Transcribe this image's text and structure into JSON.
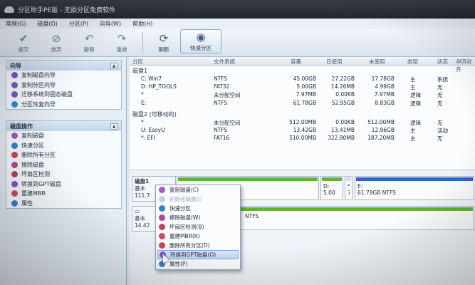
{
  "window": {
    "title": "分区助手PE版 - 无损分区免费软件"
  },
  "menu": [
    "常规(G)",
    "磁盘(D)",
    "分区(P)",
    "向导(W)",
    "帮助(H)"
  ],
  "toolbar": {
    "submit": "提交",
    "discard": "放弃",
    "undo": "撤销",
    "redo": "重做",
    "refresh": "刷新",
    "quick_partition": "快速分区"
  },
  "wizard_panel": {
    "title": "向导",
    "items": [
      "复制磁盘向导",
      "复制分区向导",
      "迁移系统到固态磁盘",
      "分区恢复向导"
    ]
  },
  "disk_ops_panel": {
    "title": "磁盘操作",
    "items": [
      "复制磁盘",
      "快速分区",
      "删除所有分区",
      "擦除磁盘",
      "坏扇区检测",
      "转换到GPT磁盘",
      "重建MBR",
      "属性"
    ]
  },
  "grid": {
    "headers": [
      "分区",
      "文件系统",
      "容量",
      "已使用",
      "未使用",
      "类型",
      "状态",
      "4KB对齐"
    ],
    "disk1_label": "磁盘1",
    "disk1_rows": [
      {
        "name": "C: Win7",
        "fs": "NTFS",
        "cap": "45.00GB",
        "used": "27.22GB",
        "free": "17.78GB",
        "type": "主",
        "status": "系统"
      },
      {
        "name": "D: HP_TOOLS",
        "fs": "FAT32",
        "cap": "5.00GB",
        "used": "14.26MB",
        "free": "4.99GB",
        "type": "主",
        "status": "无"
      },
      {
        "name": "*",
        "fs": "未分配空间",
        "cap": "7.97MB",
        "used": "0.00KB",
        "free": "7.97MB",
        "type": "逻辑",
        "status": "无"
      },
      {
        "name": "E:",
        "fs": "NTFS",
        "cap": "61.78GB",
        "used": "52.95GB",
        "free": "8.83GB",
        "type": "逻辑",
        "status": "无"
      }
    ],
    "disk2_label": "磁盘2 (可移动的)",
    "disk2_rows": [
      {
        "name": "*",
        "fs": "未分配空间",
        "cap": "512.00MB",
        "used": "0.00KB",
        "free": "512.00MB",
        "type": "逻辑",
        "status": "无"
      },
      {
        "name": "U: EasyU",
        "fs": "NTFS",
        "cap": "13.42GB",
        "used": "13.41MB",
        "free": "12.96GB",
        "type": "主",
        "status": "活动"
      },
      {
        "name": "*: EFI",
        "fs": "FAT16",
        "cap": "510.00MB",
        "used": "322.80MB",
        "free": "187.20MB",
        "type": "主",
        "status": "无"
      }
    ]
  },
  "map": {
    "disk1_name": "磁盘1",
    "disk1_kind": "基本",
    "disk1_size": "111.7",
    "disk2_kind": "基本",
    "disk2_size": "14.42",
    "part_d_label": "D:",
    "part_d_size": "5.00",
    "part_star": "*",
    "part_star_size": "7",
    "part_e_label": "E:",
    "part_e_size": "61.78GB NTFS",
    "part_ntfs": "NTFS"
  },
  "context_menu": [
    {
      "label": "复制磁盘(C)",
      "disabled": false
    },
    {
      "label": "初始化磁盘(I)",
      "disabled": true
    },
    {
      "label": "快速分区",
      "disabled": false
    },
    {
      "label": "擦除磁盘(W)",
      "disabled": false
    },
    {
      "label": "坏扇区检测(B)",
      "disabled": false
    },
    {
      "label": "重建MBR(R)",
      "disabled": false
    },
    {
      "label": "删除所有分区(D)",
      "disabled": false
    },
    {
      "label": "转换到GPT磁盘(O)",
      "disabled": false
    },
    {
      "label": "属性(P)",
      "disabled": false
    }
  ],
  "colors": {
    "partition_green": "#5fb23c",
    "partition_blue": "#2f63c8",
    "highlight": "#bcd6f3"
  }
}
